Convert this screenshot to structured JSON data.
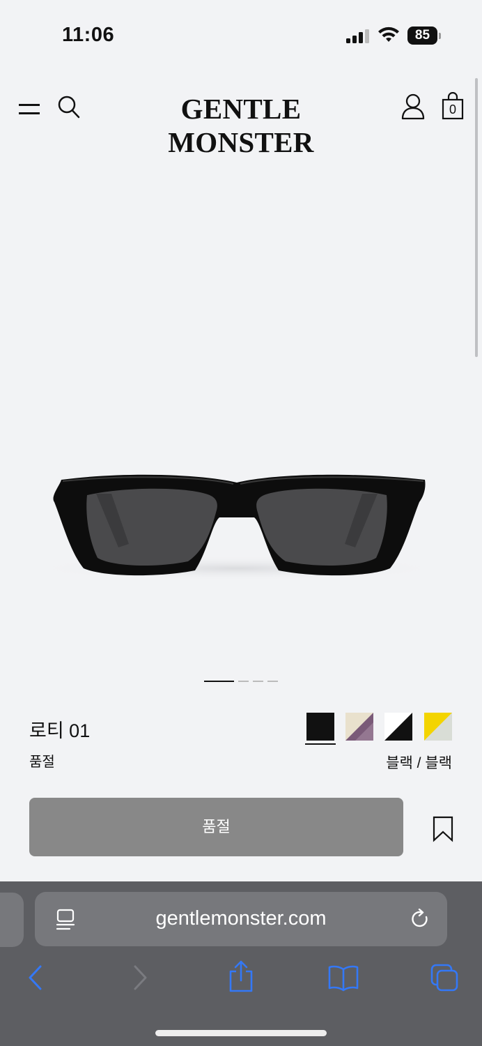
{
  "status_bar": {
    "time": "11:06",
    "battery": "85"
  },
  "header": {
    "logo": "GENTLE MONSTER",
    "cart_count": "0",
    "icons": [
      "menu-icon",
      "search-icon",
      "user-icon",
      "shopping-bag-icon"
    ]
  },
  "carousel": {
    "total_slides": 4,
    "active_slide": 1
  },
  "product": {
    "name": "로티 01",
    "status": "품절",
    "color_name": "블랙 / 블랙",
    "swatches": [
      {
        "name": "black",
        "colors": [
          "#111111",
          "#111111"
        ],
        "selected": true
      },
      {
        "name": "cream-purple",
        "colors": [
          "#e9e1cd",
          "#7a5a78"
        ],
        "selected": false
      },
      {
        "name": "white-black",
        "colors": [
          "#ffffff",
          "#111111"
        ],
        "selected": false
      },
      {
        "name": "yellow-clear",
        "colors": [
          "#f3d400",
          "#d9ddd6"
        ],
        "selected": false
      }
    ]
  },
  "actions": {
    "soldout_label": "품절"
  },
  "browser": {
    "url": "gentlemonster.com",
    "toolbar": [
      "back-icon",
      "forward-icon",
      "share-icon",
      "bookmarks-icon",
      "tabs-icon"
    ]
  },
  "colors": {
    "accent": "#3478f6",
    "button_disabled": "#888888",
    "browser_bar": "#5d5e62"
  }
}
